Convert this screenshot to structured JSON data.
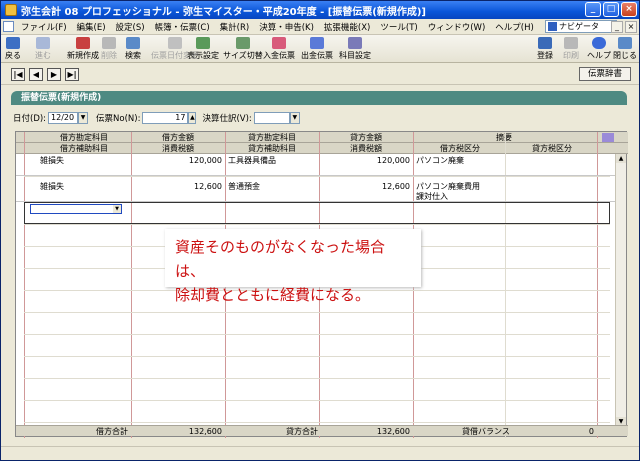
{
  "window": {
    "title": "弥生会計 08 プロフェッショナル - 弥生マイスター・平成20年度 - [振替伝票(新規作成)]",
    "win_buttons": [
      "_",
      "□",
      "×"
    ]
  },
  "menu": {
    "items": [
      "ファイル(F)",
      "編集(E)",
      "設定(S)",
      "帳簿・伝票(C)",
      "集計(R)",
      "決算・申告(K)",
      "拡張機能(X)",
      "ツール(T)",
      "ウィンドウ(W)",
      "ヘルプ(H)"
    ],
    "navigator": "ナビゲータ",
    "mdi_buttons": [
      "_",
      "×"
    ]
  },
  "toolbar": {
    "back": "戻る",
    "next": "進む",
    "new": "新規作成",
    "delete": "削除",
    "search": "検索",
    "hidden": "伝票日付変更",
    "display": "表示設定",
    "size": "サイズ切替",
    "in_slip": "入金伝票",
    "out_slip": "出金伝票",
    "account": "科目設定",
    "register": "登録",
    "print": "印刷",
    "help": "ヘルプ",
    "close": "閉じる"
  },
  "nav": {
    "first": "|◀",
    "prev": "◀",
    "next": "▶",
    "last": "▶|",
    "dict": "伝票辞書"
  },
  "form": {
    "header": "振替伝票(新規作成)",
    "date_label": "日付(D):",
    "date_value": "12/20",
    "slipno_label": "伝票No(N):",
    "slipno_value": "17",
    "settle_label": "決算仕訳(V):",
    "settle_value": ""
  },
  "grid": {
    "headers1": [
      "借方勘定科目",
      "借方金額",
      "貸方勘定科目",
      "貸方金額",
      "摘要"
    ],
    "headers2": [
      "借方補助科目",
      "消費税額",
      "貸方補助科目",
      "消費税額",
      "借方税区分",
      "貸方税区分"
    ],
    "rows": [
      {
        "debit_account": "雑損失",
        "debit_amount": "120,000",
        "credit_account": "工具器具備品",
        "credit_amount": "120,000",
        "memo": "パソコン廃棄",
        "memo2": ""
      },
      {
        "debit_account": "雑損失",
        "debit_amount": "12,600",
        "credit_account": "普通預金",
        "credit_amount": "12,600",
        "memo": "パソコン廃棄費用",
        "memo2": "課対仕入"
      }
    ],
    "footer": {
      "debit_total_label": "借方合計",
      "debit_total": "132,600",
      "credit_total_label": "貸方合計",
      "credit_total": "132,600",
      "balance_label": "貸借バランス",
      "balance": "0"
    }
  },
  "callout": {
    "line1": "資産そのものがなくなった場合は、",
    "line2": "除却費とともに経費になる。"
  },
  "colors": {
    "title": "#0a55d8",
    "header": "#4e8a82",
    "callout": "#cc1111"
  }
}
